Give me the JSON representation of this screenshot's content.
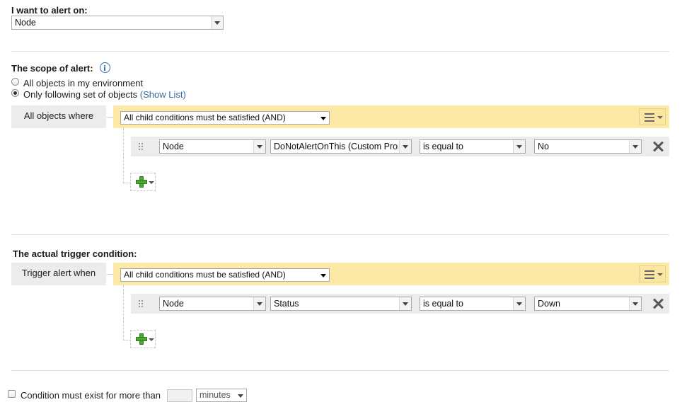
{
  "alert_on": {
    "label": "I want to alert on:",
    "selected": "Node"
  },
  "scope": {
    "label": "The scope of alert:",
    "info_icon": "info-icon",
    "option_all": "All objects in my environment",
    "option_following": "Only following set of objects",
    "show_list": "(Show List)",
    "selected_option": "following",
    "group_tag": "All objects where",
    "group_operator": "All child conditions must be satisfied (AND)",
    "condition": {
      "object": "Node",
      "field": "DoNotAlertOnThis (Custom Prop",
      "operator": "is equal to",
      "value": "No"
    }
  },
  "trigger": {
    "label": "The actual trigger condition:",
    "group_tag": "Trigger alert when",
    "group_operator": "All child conditions must be satisfied (AND)",
    "condition": {
      "object": "Node",
      "field": "Status",
      "operator": "is equal to",
      "value": "Down"
    }
  },
  "duration": {
    "label": "Condition must exist for more than",
    "value": "",
    "unit": "minutes",
    "checked": false
  }
}
